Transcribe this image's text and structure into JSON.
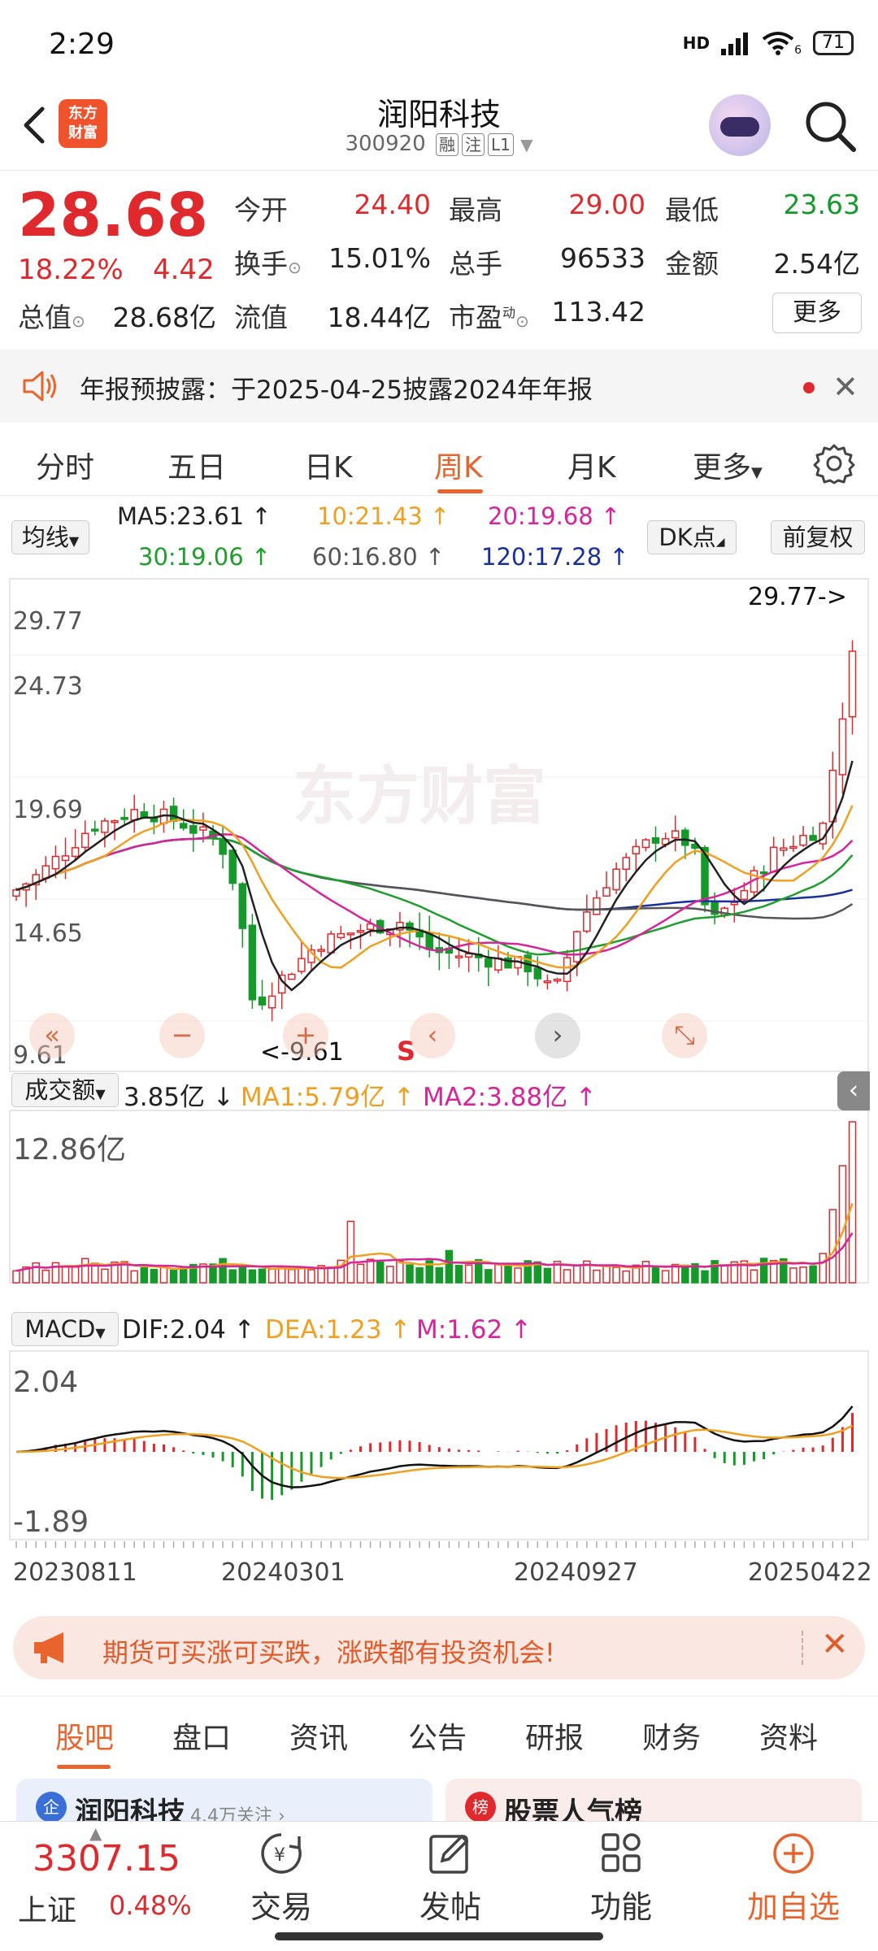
{
  "status": {
    "time": "2:29",
    "network": "HD",
    "battery": "71",
    "wifi_sub": "6"
  },
  "header": {
    "logo_text_1": "东方",
    "logo_text_2": "财富",
    "stock_name": "润阳科技",
    "stock_code": "300920",
    "tags": [
      "融",
      "注",
      "L1"
    ]
  },
  "quote": {
    "price": "28.68",
    "change_pct": "18.22%",
    "change_amt": "4.42",
    "rows": [
      [
        {
          "label": "今开",
          "value": "24.40",
          "color": "red"
        },
        {
          "label": "最高",
          "value": "29.00",
          "color": "red"
        },
        {
          "label": "最低",
          "value": "23.63",
          "color": "green"
        }
      ],
      [
        {
          "label": "换手",
          "value": "15.01%",
          "color": "dark"
        },
        {
          "label": "总手",
          "value": "96533",
          "color": "dark"
        },
        {
          "label": "金额",
          "value": "2.54亿",
          "color": "dark"
        }
      ],
      [
        {
          "label": "总值",
          "value": "28.68亿",
          "color": "dark"
        },
        {
          "label": "流值",
          "value": "18.44亿",
          "color": "dark"
        },
        {
          "label": "市盈",
          "value": "113.42",
          "color": "dark"
        }
      ]
    ],
    "pe_sup": "动",
    "more_label": "更多"
  },
  "notice": {
    "text": "年报预披露：于2025-04-25披露2024年年报",
    "close": "✕"
  },
  "period_tabs": [
    "分时",
    "五日",
    "日K",
    "周K",
    "月K",
    "更多"
  ],
  "period_active": "周K",
  "ma": {
    "selector": "均线",
    "items": [
      {
        "label": "MA5:23.61",
        "color": "#222222"
      },
      {
        "label": "10:21.43",
        "color": "#f0a020"
      },
      {
        "label": "20:19.68",
        "color": "#d6249a"
      },
      {
        "label": "30:19.06",
        "color": "#1e9e2c"
      },
      {
        "label": "60:16.80",
        "color": "#555555"
      },
      {
        "label": "120:17.28",
        "color": "#1a2f9e"
      }
    ],
    "dk_label": "DK点",
    "adjust_label": "前复权"
  },
  "kline": {
    "y_labels": [
      "29.77",
      "24.73",
      "19.69",
      "14.65",
      "9.61"
    ],
    "max_label": "29.77->",
    "min_label": "<-9.61",
    "signal": "S",
    "watermark": "东方财富"
  },
  "volume": {
    "selector": "成交额",
    "value": "3.85亿",
    "ma1": "MA1:5.79亿",
    "ma2": "MA2:3.88亿",
    "ymax": "12.86亿"
  },
  "macd": {
    "selector": "MACD",
    "dif": "DIF:2.04",
    "dea": "DEA:1.23",
    "m": "M:1.62",
    "ymax": "2.04",
    "ymin": "-1.89"
  },
  "dates": [
    "20230811",
    "20240301",
    "20240927",
    "20250422"
  ],
  "colors": {
    "up": "#e0292c",
    "down": "#159a2a",
    "accent": "#e8642c"
  },
  "ad": {
    "text": "期货可买涨可买跌，涨跌都有投资机会!",
    "close": "✕"
  },
  "info_tabs": [
    "股吧",
    "盘口",
    "资讯",
    "公告",
    "研报",
    "财务",
    "资料"
  ],
  "info_active": "股吧",
  "cards": [
    {
      "badge": "企",
      "title": "润阳科技",
      "sub": "4.4万关注 ›"
    },
    {
      "badge": "榜",
      "title": "股票人气榜",
      "sub": ""
    }
  ],
  "index": {
    "value": "3307.15",
    "name": "上证",
    "pct": "0.48%"
  },
  "nav": [
    {
      "label": "交易",
      "icon": "yen-circle-icon"
    },
    {
      "label": "发帖",
      "icon": "edit-icon"
    },
    {
      "label": "功能",
      "icon": "apps-icon"
    },
    {
      "label": "加自选",
      "icon": "plus-circle-icon"
    }
  ]
}
